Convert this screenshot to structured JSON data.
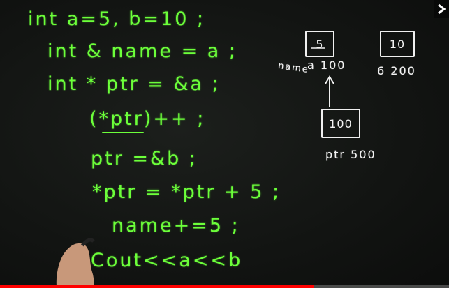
{
  "board": {
    "code_lines": [
      "int a=5, b=10 ;",
      "int & name = a ;",
      "int * ptr = &a ;",
      "(*ptr)++ ;",
      "ptr =&b ;",
      "*ptr = *ptr + 5 ;",
      "name+=5 ;",
      "Cout<<a<<b"
    ],
    "diagram": {
      "box_a_value": "5",
      "box_b_value": "10",
      "box_ptr_value": "100",
      "alias_label": "name",
      "var_a_label": "a 100",
      "var_b_label": "6 200",
      "var_ptr_label": "ptr 500"
    }
  },
  "player": {
    "progress_fraction": 0.7,
    "accent_color": "#ff0000",
    "next_icon": "chevron-right-icon"
  }
}
